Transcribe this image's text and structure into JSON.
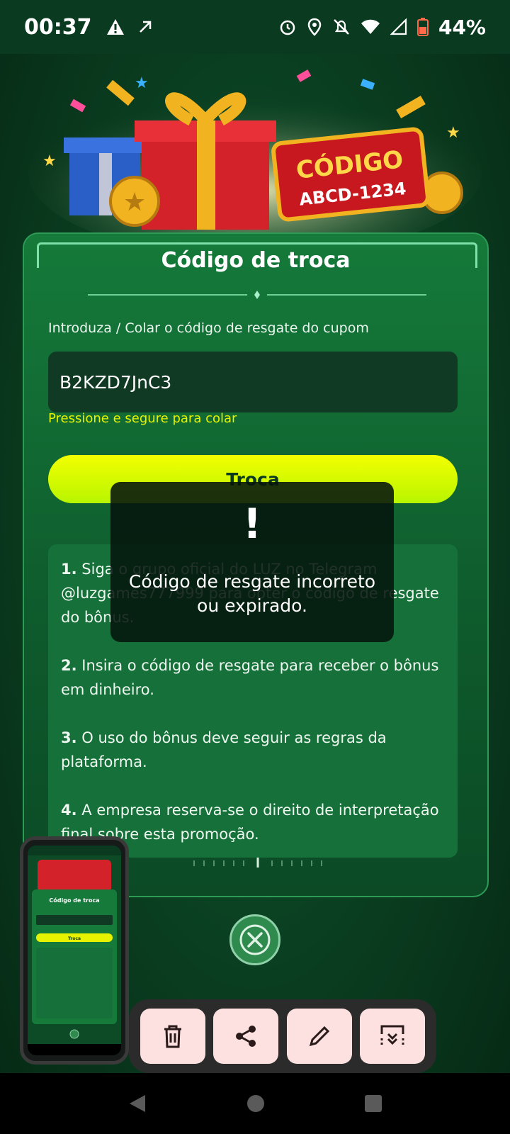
{
  "status_bar": {
    "time": "00:37",
    "battery": "44%",
    "icons": [
      "warning-icon",
      "arrow-icon",
      "alarm-icon",
      "location-icon",
      "bell-off-icon",
      "wifi-icon",
      "signal-icon",
      "battery-icon"
    ]
  },
  "banner": {
    "code_title": "CÓDIGO",
    "code_sample": "ABCD-1234"
  },
  "card": {
    "title": "Código de troca",
    "input_label": "Introduza / Colar o código de resgate do cupom",
    "input_value": "B2KZD7JnC3",
    "paste_hint": "Pressione e segure para colar",
    "submit_label": "Troca"
  },
  "rules": [
    {
      "num": "1.",
      "text": "Siga o grupo oficial do LUZ no Telegram @luzgames777999 para obter o código de resgate do bônus."
    },
    {
      "num": "2.",
      "text": "Insira o código de resgate para receber o bônus em dinheiro."
    },
    {
      "num": "3.",
      "text": "O uso do bônus deve seguir as regras da plataforma."
    },
    {
      "num": "4.",
      "text": "A empresa reserva-se o direito de interpretação final sobre esta promoção."
    }
  ],
  "toast": {
    "icon": "!",
    "message": "Código de resgate incorreto ou expirado."
  },
  "thumbnail": {
    "title": "Código de troca",
    "button": "Troca"
  },
  "colors": {
    "accent_yellow": "#e6f200",
    "card_green": "#157a3a",
    "toast_bg": "#05140c",
    "action_btn_bg": "#fde1e1"
  }
}
